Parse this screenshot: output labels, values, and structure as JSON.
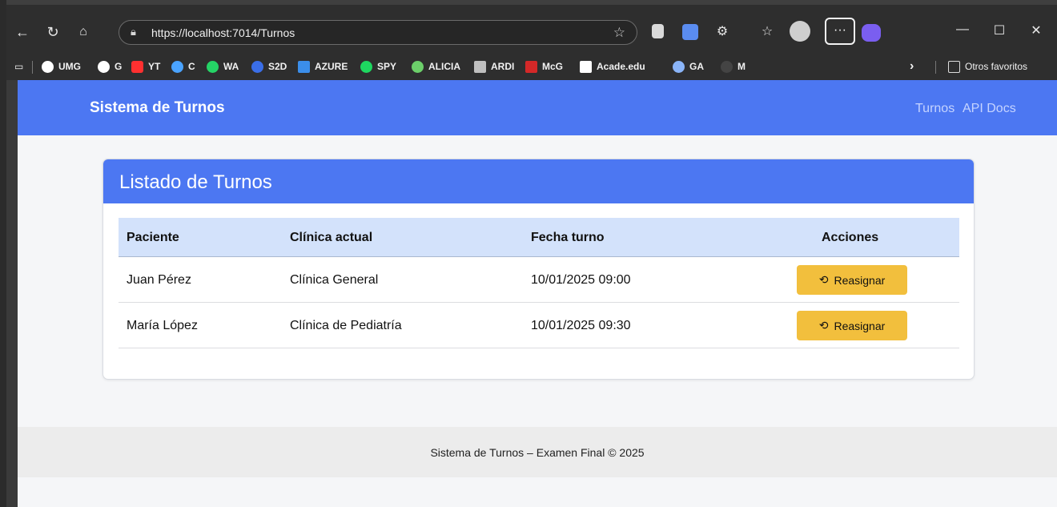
{
  "browser": {
    "url": "https://localhost:7014/Turnos",
    "more_label": "···",
    "bookmarks": [
      {
        "label": "UMG",
        "color": "#ffffff"
      },
      {
        "label": "G",
        "color": "#ffffff"
      },
      {
        "label": "YT",
        "color": "#ff3030"
      },
      {
        "label": "C",
        "color": "#4aa3ff"
      },
      {
        "label": "WA",
        "color": "#25d366"
      },
      {
        "label": "S2D",
        "color": "#3a6ee8"
      },
      {
        "label": "AZURE",
        "color": "#3b8eea"
      },
      {
        "label": "SPY",
        "color": "#1ed760"
      },
      {
        "label": "ALICIA",
        "color": "#6ccf6a"
      },
      {
        "label": "ARDI",
        "color": "#bfbfbf"
      },
      {
        "label": "McG",
        "color": "#d42828"
      },
      {
        "label": "Acade.edu",
        "color": "#ffffff"
      },
      {
        "label": "GA",
        "color": "#8ab4f8"
      },
      {
        "label": "M",
        "color": "#444444"
      }
    ],
    "other_favorites": "Otros favoritos"
  },
  "header": {
    "brand": "Sistema de Turnos",
    "nav": [
      "Turnos",
      "API Docs"
    ]
  },
  "card": {
    "title": "Listado de Turnos"
  },
  "table": {
    "columns": [
      "Paciente",
      "Clínica actual",
      "Fecha turno",
      "Acciones"
    ],
    "rows": [
      {
        "paciente": "Juan Pérez",
        "clinica": "Clínica General",
        "fecha": "10/01/2025 09:00",
        "accion": "Reasignar"
      },
      {
        "paciente": "María López",
        "clinica": "Clínica de Pediatría",
        "fecha": "10/01/2025 09:30",
        "accion": "Reasignar"
      }
    ]
  },
  "footer": {
    "text": "Sistema de Turnos – Examen Final © 2025"
  },
  "colors": {
    "primary": "#4c77f2",
    "table_header": "#d3e2fb",
    "warning_button": "#f2bf3d"
  }
}
